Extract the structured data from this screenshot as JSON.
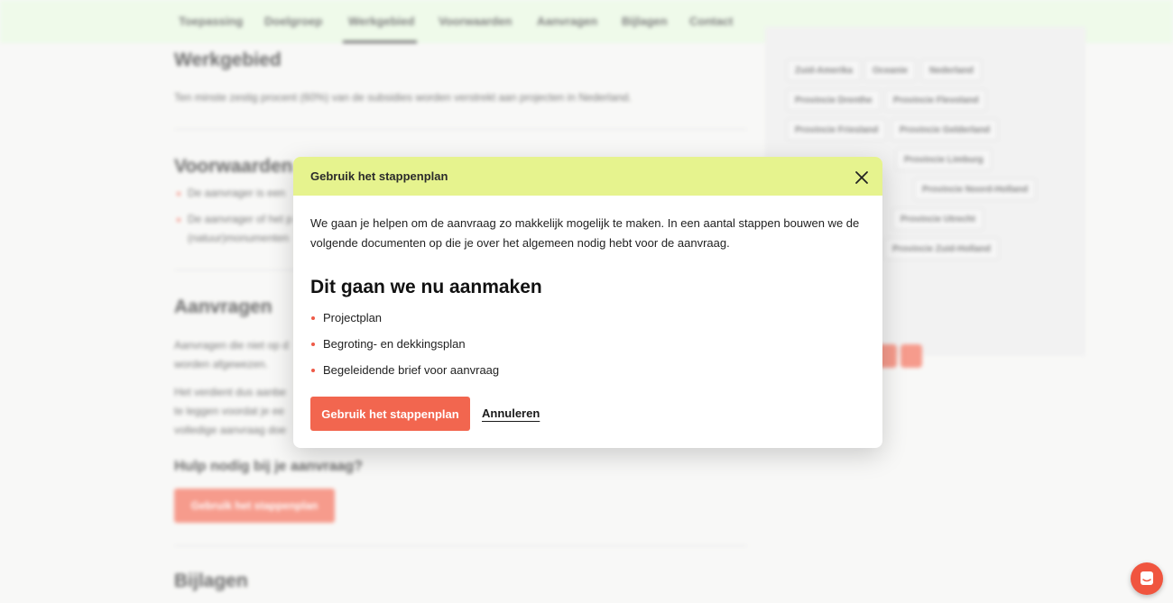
{
  "nav": {
    "items": [
      "Toepassing",
      "Doelgroep",
      "Werkgebied",
      "Voorwaarden",
      "Aanvragen",
      "Bijlagen",
      "Contact"
    ],
    "active": "Werkgebied"
  },
  "content": {
    "werkgebied_title": "Werkgebied",
    "werkgebied_text": "Ten minste zestig procent (60%) van de subsidies worden verstrekt aan projecten in Nederland.",
    "voorwaarden_title": "Voorwaarden",
    "voorwaarden_items": [
      "De aanvrager is een",
      "De aanvrager of het p"
    ],
    "voorwaarden_item2_cont": "(natuur)monumenten",
    "aanvragen_title": "Aanvragen",
    "aanvragen_p1": [
      "Aanvragen die niet op d",
      "worden afgewezen."
    ],
    "aanvragen_p2": [
      "Het verdient dus aanbe",
      "te leggen voordat je ee",
      "volledige aanvraag doe"
    ],
    "help_title": "Hulp nodig bij je aanvraag?",
    "help_button": "Gebruik het stappenplan",
    "bijlagen_title": "Bijlagen"
  },
  "sidebar": {
    "tags": [
      "Zuid-Amerika",
      "Oceanie",
      "Nederland",
      "Provincie Drenthe",
      "Provincie Flevoland",
      "Provincie Friesland",
      "Provincie Gelderland",
      "Provincie Limburg",
      "Provincie Noord-Holland",
      "Provincie Utrecht",
      "Provincie Zuid-Holland"
    ]
  },
  "modal": {
    "title": "Gebruik het stappenplan",
    "intro": "We gaan je helpen om de aanvraag zo makkelijk mogelijk te maken. In een aantal stappen bouwen we de volgende documenten op die je over het algemeen nodig hebt voor de aanvraag.",
    "heading": "Dit gaan we nu aanmaken",
    "items": [
      "Projectplan",
      "Begroting- en dekkingsplan",
      "Begeleidende brief voor aanvraag"
    ],
    "primary_button": "Gebruik het stappenplan",
    "cancel": "Annuleren"
  },
  "colors": {
    "accent": "#f2664f",
    "modal_header": "#e6f38e",
    "nav_bg": "#e6f7df"
  }
}
